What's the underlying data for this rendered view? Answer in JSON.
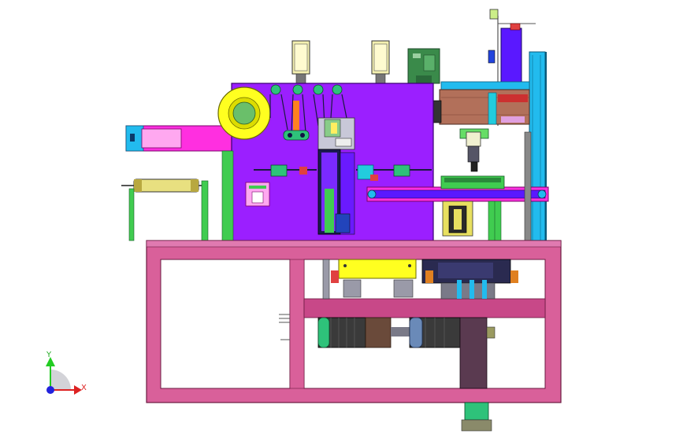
{
  "triad": {
    "y_label": "Y",
    "x_label": "X"
  },
  "colors": {
    "frame_pink": "#d9609a",
    "frame_pink_dark": "#b04078",
    "plate_purple": "#9b1fff",
    "plate_purple_dark": "#6a10c0",
    "magenta": "#ff2fe0",
    "cyan": "#22bbee",
    "yellow": "#ffff00",
    "green": "#33cc66",
    "dark_green": "#2a8a3a",
    "navy": "#1a1a60",
    "grey": "#9a9aa8"
  }
}
